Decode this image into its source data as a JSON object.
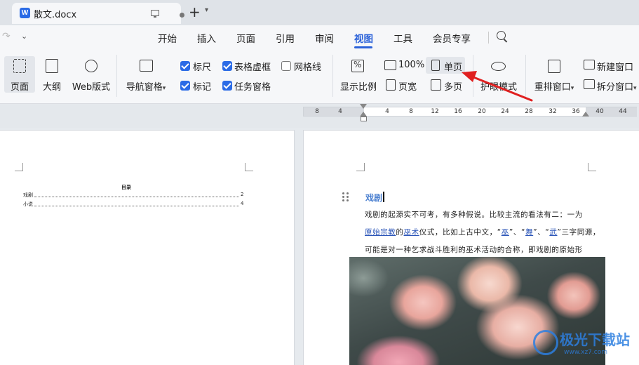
{
  "window": {
    "tab_title": "散文.docx",
    "app_badge": "W",
    "new_tab_symbol": "+"
  },
  "menu": {
    "items": [
      "开始",
      "插入",
      "页面",
      "引用",
      "审阅",
      "视图",
      "工具",
      "会员专享"
    ],
    "active": "视图"
  },
  "ribbon": {
    "view_buttons": [
      {
        "label": "页面",
        "icon": "page-view-icon",
        "selected": true
      },
      {
        "label": "大纲",
        "icon": "outline-icon",
        "selected": false
      },
      {
        "label": "Web版式",
        "icon": "globe-icon",
        "selected": false
      }
    ],
    "nav_pane_label": "导航窗格",
    "checkboxes": [
      {
        "label": "标尺",
        "checked": true
      },
      {
        "label": "表格虚框",
        "checked": true
      },
      {
        "label": "网格线",
        "checked": false
      },
      {
        "label": "标记",
        "checked": true
      },
      {
        "label": "任务窗格",
        "checked": true
      }
    ],
    "zoom_label": "显示比例",
    "zoom_100_label": "100%",
    "page_width_label": "页宽",
    "single_page_label": "单页",
    "multi_page_label": "多页",
    "eye_mode_label": "护眼模式",
    "rearrange_label": "重排窗口",
    "new_window_label": "新建窗口",
    "split_window_label": "拆分窗口"
  },
  "ruler": {
    "numbers": [
      "8",
      "4",
      "4",
      "8",
      "12",
      "16",
      "20",
      "24",
      "28",
      "32",
      "36",
      "40",
      "44"
    ]
  },
  "document": {
    "toc": {
      "title": "目录",
      "entries": [
        {
          "text": "戏剧",
          "page": "2"
        },
        {
          "text": "小说",
          "page": "4"
        }
      ]
    },
    "heading": "戏剧",
    "para_lines": [
      "戏剧的起源实不可考，有多种假说。比较主流的看法有二：一为",
      "可能是对一种乞求战斗胜利的巫术活动的合称，即戏剧的原始形"
    ],
    "para_line2": {
      "link1": "原始宗教",
      "t1": "的",
      "link2": "巫术",
      "t2": "仪式，比如上古中文，“",
      "link3": "巫",
      "t3": "”、“",
      "link4": "舞",
      "t4": "”、“",
      "link5": "武",
      "t5": "”三字同源，"
    }
  },
  "watermark": {
    "text": "极光下载站",
    "url": "www.xz7.com"
  },
  "colors": {
    "accent": "#2b62d9",
    "checkbox": "#2b6be6",
    "annotation_arrow": "#e02020",
    "heading": "#4a7fd0"
  }
}
